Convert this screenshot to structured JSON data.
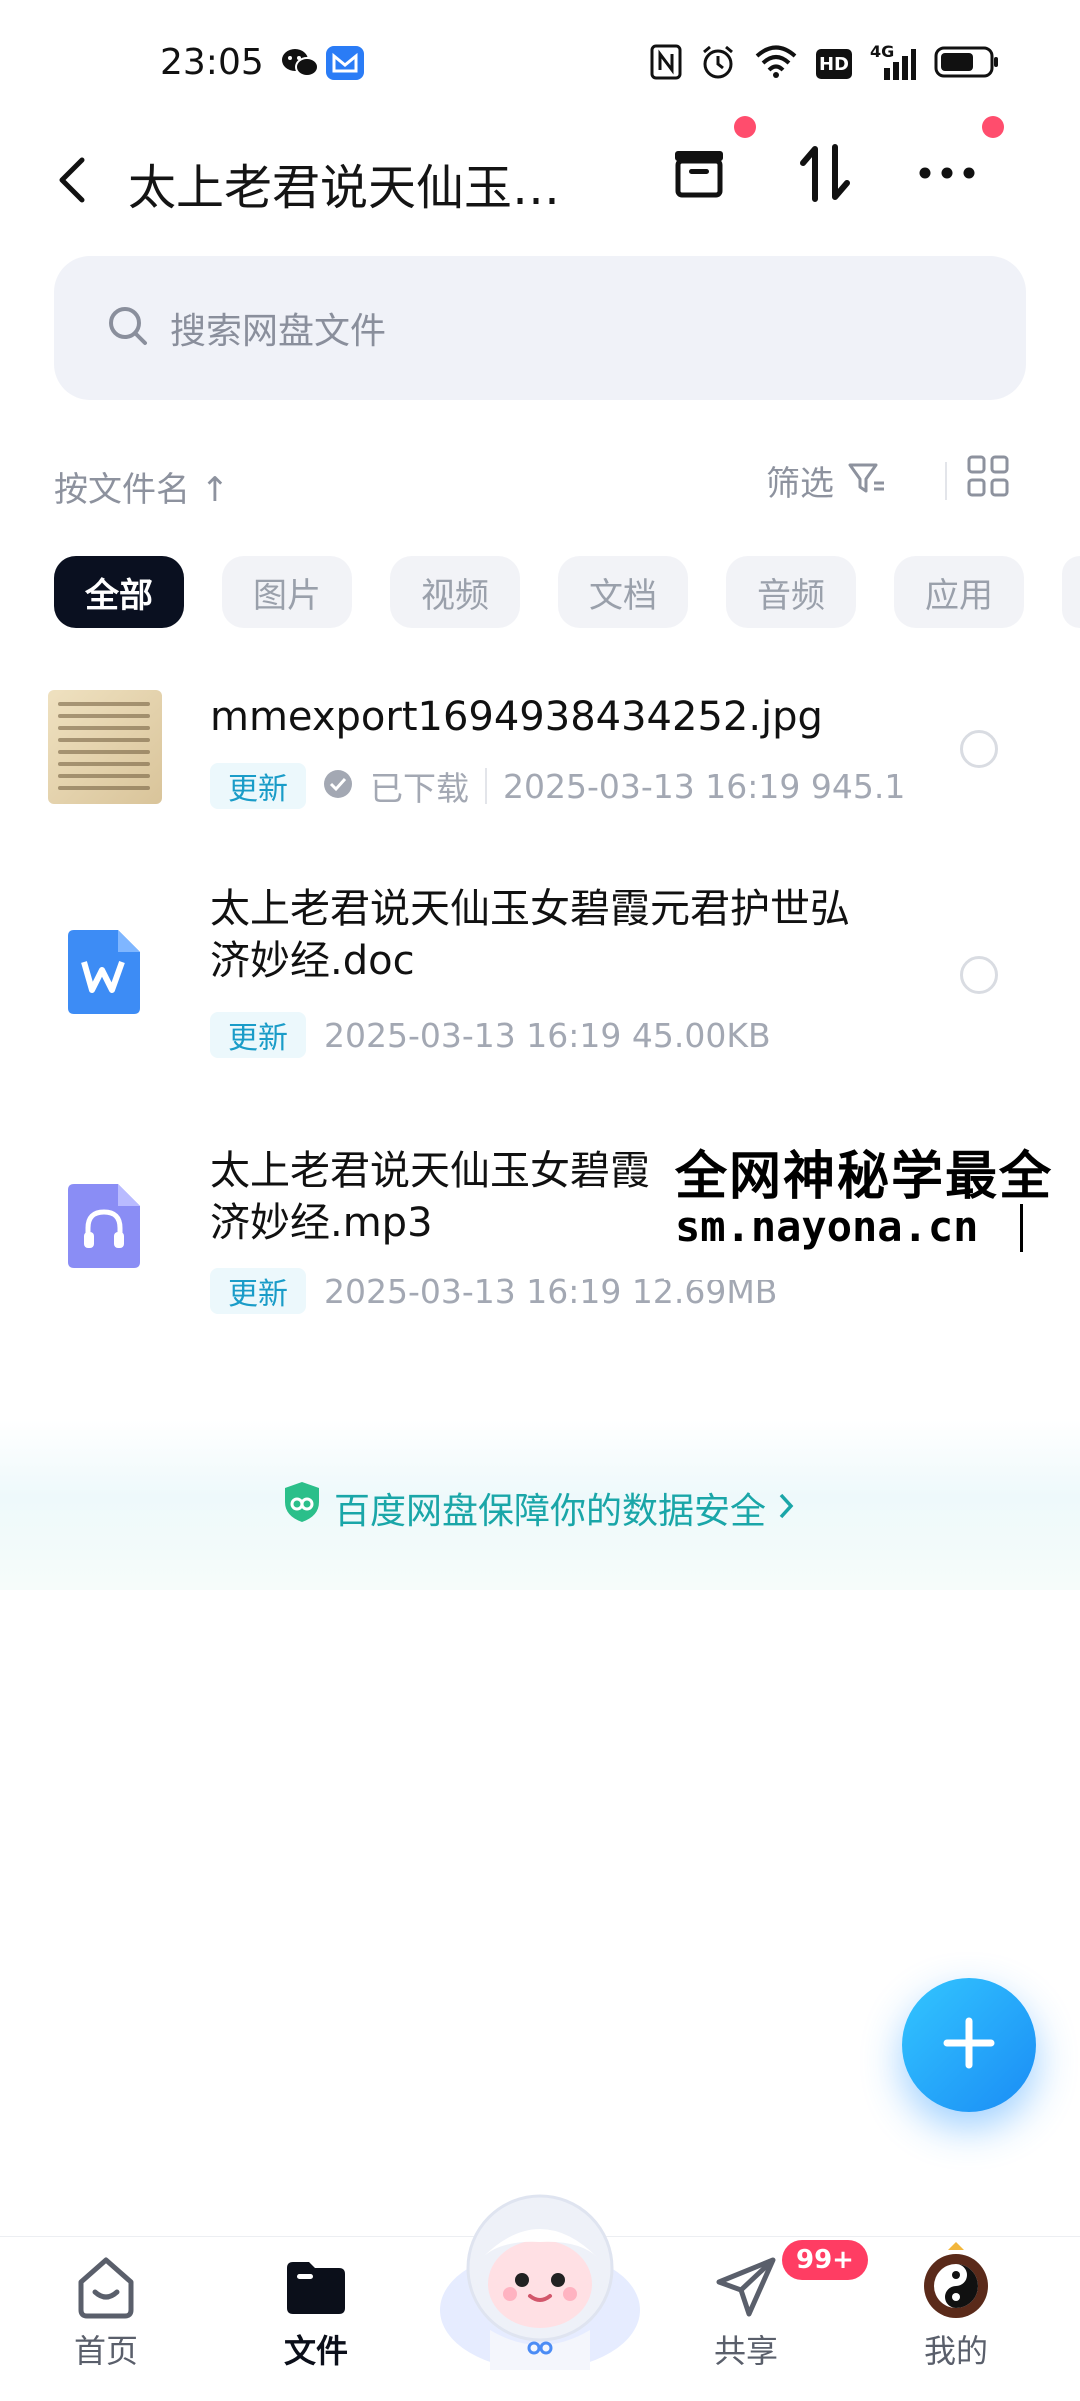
{
  "status_bar": {
    "time": "23:05",
    "network": "4G",
    "hd": "HD",
    "icons": [
      "wechat-icon",
      "mail-app-icon",
      "nfc-icon",
      "alarm-icon",
      "wifi-icon",
      "hd-icon",
      "signal-icon",
      "battery-icon"
    ]
  },
  "header": {
    "title": "太上老君说天仙玉…",
    "actions": [
      "archive-icon",
      "sort-arrows-icon",
      "more-icon"
    ]
  },
  "search": {
    "placeholder": "搜索网盘文件"
  },
  "sort_bar": {
    "sort_label": "按文件名 ↑",
    "filter_label": "筛选"
  },
  "filter_chips": [
    {
      "label": "全部",
      "active": true
    },
    {
      "label": "图片",
      "active": false
    },
    {
      "label": "视频",
      "active": false
    },
    {
      "label": "文档",
      "active": false
    },
    {
      "label": "音频",
      "active": false
    },
    {
      "label": "应用",
      "active": false
    }
  ],
  "files": [
    {
      "name": "mmexport1694938434252.jpg",
      "badge": "更新",
      "downloaded_label": "已下载",
      "meta": "2025-03-13  16:19   945.1",
      "icon": "image-thumbnail"
    },
    {
      "name_line1": "太上老君说天仙玉女碧霞元君护世弘",
      "name_line2": "济妙经.doc",
      "badge": "更新",
      "meta": "2025-03-13  16:19   45.00KB",
      "icon": "word-doc-icon"
    },
    {
      "name_line1": "太上老君说天仙玉女碧霞",
      "name_line2": "济妙经.mp3",
      "badge": "更新",
      "meta": "2025-03-13  16:19   12.69MB",
      "icon": "audio-file-icon"
    }
  ],
  "watermark": {
    "line1": "全网神秘学最全",
    "line2": "sm.nayona.cn"
  },
  "security_banner": {
    "text": "百度网盘保障你的数据安全"
  },
  "bottom_nav": {
    "items": [
      {
        "label": "首页",
        "active": false
      },
      {
        "label": "文件",
        "active": true
      },
      {
        "label": "",
        "active": false
      },
      {
        "label": "共享",
        "active": false
      },
      {
        "label": "我的",
        "active": false
      }
    ],
    "share_badge": "99+"
  },
  "colors": {
    "accent": "#1a9cc8",
    "fab": "#1a8cf5",
    "notification": "#ff4d6d",
    "active_chip": "#0a1020"
  }
}
